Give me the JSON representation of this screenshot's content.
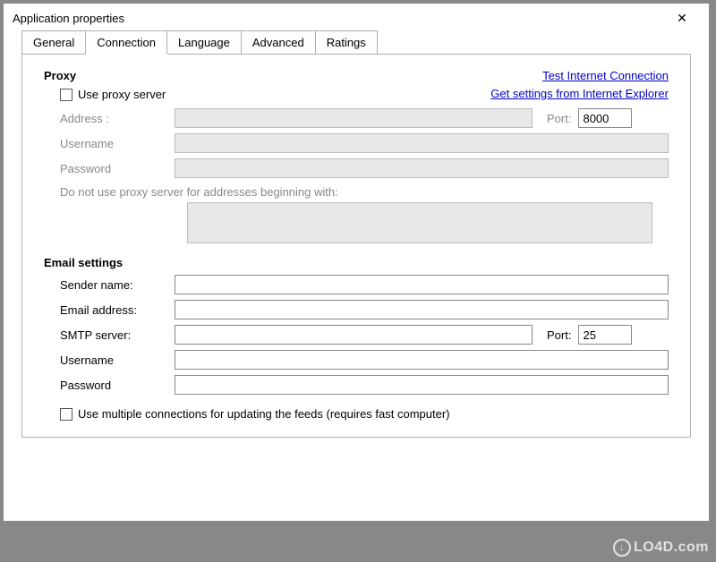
{
  "window": {
    "title": "Application properties",
    "close_glyph": "✕"
  },
  "tabs": {
    "items": [
      "General",
      "Connection",
      "Language",
      "Advanced",
      "Ratings"
    ],
    "active": "Connection"
  },
  "proxy": {
    "heading": "Proxy",
    "use_proxy_label": "Use proxy server",
    "address_label": "Address :",
    "username_label": "Username",
    "password_label": "Password",
    "port_label": "Port:",
    "port_value": "8000",
    "exclude_label": "Do not use proxy server for addresses beginning with:",
    "link_test": "Test Internet Connection",
    "link_get_ie": "Get settings from Internet Explorer"
  },
  "email": {
    "heading": "Email settings",
    "sender_label": "Sender name:",
    "address_label": "Email address:",
    "smtp_label": "SMTP server:",
    "port_label": "Port:",
    "port_value": "25",
    "username_label": "Username",
    "password_label": "Password"
  },
  "multi_conn": {
    "label": "Use multiple connections for updating the feeds (requires fast computer)"
  },
  "watermark": {
    "text": "LO4D.com",
    "glyph": "↓"
  }
}
